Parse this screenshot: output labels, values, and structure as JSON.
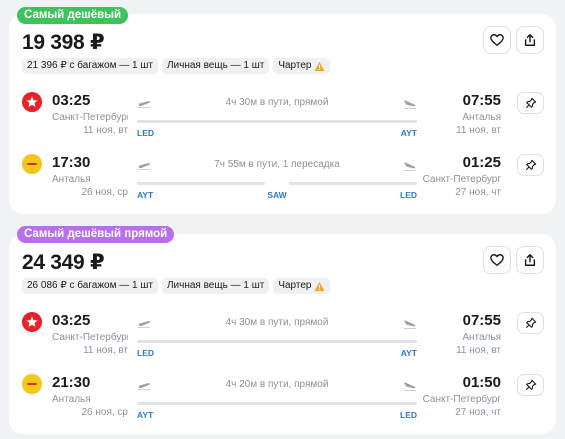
{
  "offers": [
    {
      "badge": "Самый дешёвый",
      "badge_color": "#3cc45a",
      "price": "19 398 ₽",
      "tags": {
        "baggage": "21 396 ₽ с багажом — 1 шт",
        "personal": "Личная вещь — 1 шт",
        "charter": "Чартер"
      },
      "segments": [
        {
          "airline_logo": "red-star-logo",
          "dep_time": "03:25",
          "dep_city": "Санкт-Петербург",
          "dep_date": "11 ноя, вт",
          "duration": "4ч 30м в пути, прямой",
          "dep_code": "LED",
          "mid_code": "",
          "arr_code": "AYT",
          "arr_time": "07:55",
          "arr_city": "Анталья",
          "arr_date": "11 ноя, вт"
        },
        {
          "airline_logo": "yellow-logo",
          "dep_time": "17:30",
          "dep_city": "Анталья",
          "dep_date": "26 ноя, ср",
          "duration": "7ч 55м в пути, 1 пересадка",
          "dep_code": "AYT",
          "mid_code": "SAW",
          "arr_code": "LED",
          "arr_time": "01:25",
          "arr_city": "Санкт-Петербург",
          "arr_date": "27 ноя, чт"
        }
      ]
    },
    {
      "badge": "Самый дешёвый прямой",
      "badge_color": "#b76ff0",
      "price": "24 349 ₽",
      "tags": {
        "baggage": "26 086 ₽ с багажом — 1 шт",
        "personal": "Личная вещь — 1 шт",
        "charter": "Чартер"
      },
      "segments": [
        {
          "airline_logo": "red-star-logo",
          "dep_time": "03:25",
          "dep_city": "Санкт-Петербург",
          "dep_date": "11 ноя, вт",
          "duration": "4ч 30м в пути, прямой",
          "dep_code": "LED",
          "mid_code": "",
          "arr_code": "AYT",
          "arr_time": "07:55",
          "arr_city": "Анталья",
          "arr_date": "11 ноя, вт"
        },
        {
          "airline_logo": "yellow-logo",
          "dep_time": "21:30",
          "dep_city": "Анталья",
          "dep_date": "26 ноя, ср",
          "duration": "4ч 20м в пути, прямой",
          "dep_code": "AYT",
          "mid_code": "",
          "arr_code": "LED",
          "arr_time": "01:50",
          "arr_city": "Санкт-Петербург",
          "arr_date": "27 ноя, чт"
        }
      ]
    }
  ],
  "colors": {
    "accent_code": "#2a7ad6",
    "muted_text": "#8b929c",
    "warning": "#f5a623"
  }
}
